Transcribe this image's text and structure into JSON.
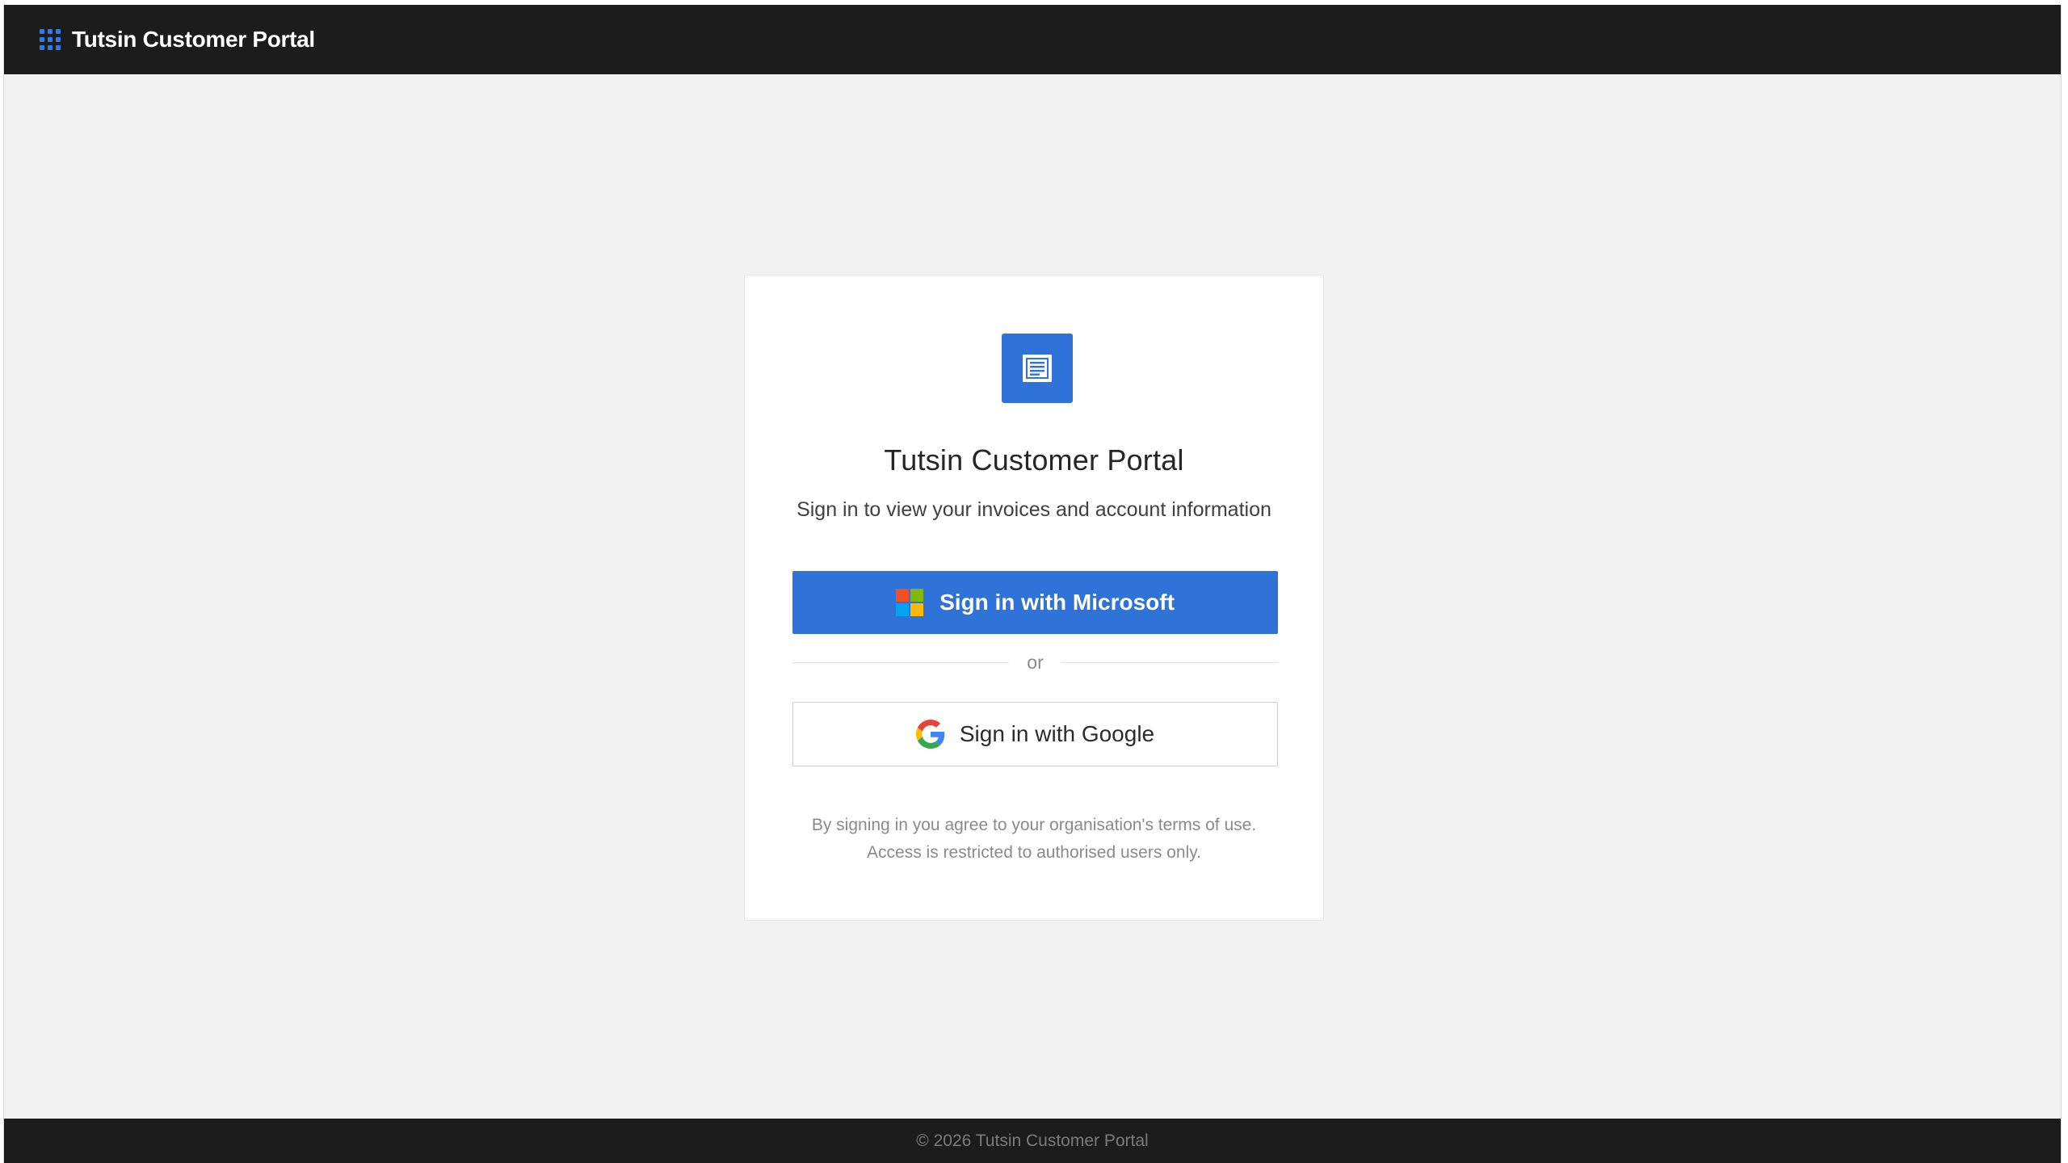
{
  "header": {
    "title": "Tutsin Customer Portal",
    "icon": "apps-grid-icon"
  },
  "card": {
    "logo_icon": "invoice-document-icon",
    "title": "Tutsin Customer Portal",
    "subtitle": "Sign in to view your invoices and account information",
    "microsoft_button": {
      "label": "Sign in with Microsoft",
      "icon": "microsoft-logo-icon"
    },
    "divider_text": "or",
    "google_button": {
      "label": "Sign in with Google",
      "icon": "google-logo-icon"
    },
    "terms_line1": "By signing in you agree to your organisation's terms of use.",
    "terms_line2": "Access is restricted to authorised users only."
  },
  "footer": {
    "text": "© 2026 Tutsin Customer Portal"
  },
  "colors": {
    "header_bg": "#1c1c1c",
    "page_bg": "#f2f2f2",
    "accent": "#2f72d8",
    "microsoft": [
      "#f25022",
      "#7fba00",
      "#00a4ef",
      "#ffb900"
    ]
  }
}
